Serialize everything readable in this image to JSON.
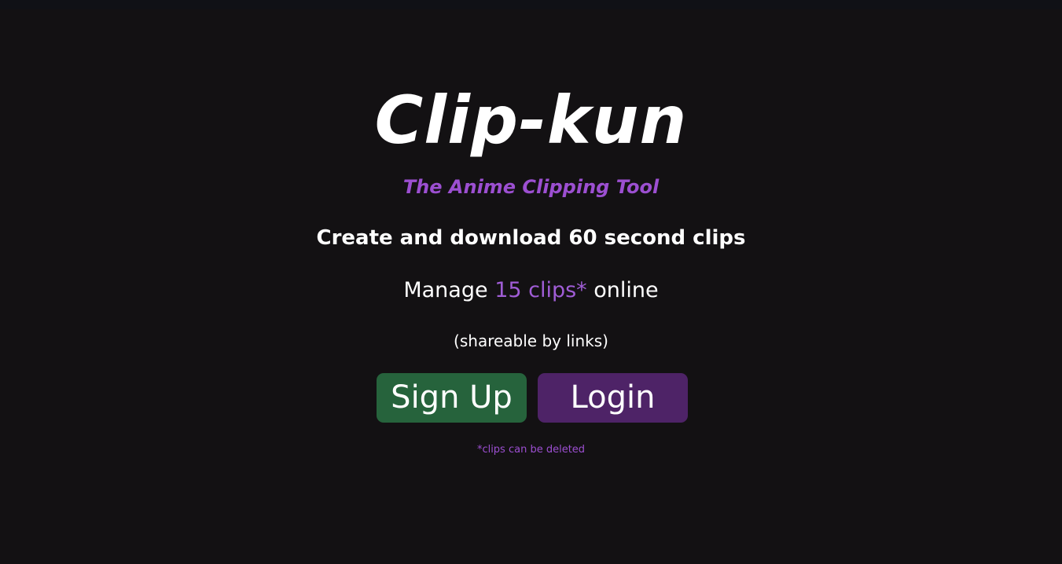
{
  "hero": {
    "title": "Clip-kun",
    "tagline": "The Anime Clipping Tool",
    "headline": "Create and download 60 second clips",
    "manage": {
      "prefix": "Manage ",
      "accent": "15 clips*",
      "suffix": " online"
    },
    "shareable": "(shareable by links)"
  },
  "actions": {
    "signup_label": "Sign Up",
    "login_label": "Login"
  },
  "footnote": "*clips can be deleted",
  "colors": {
    "background": "#131113",
    "accent_purple": "#9c4fd1",
    "signup_green": "#26633c",
    "login_purple": "#4e2367"
  }
}
